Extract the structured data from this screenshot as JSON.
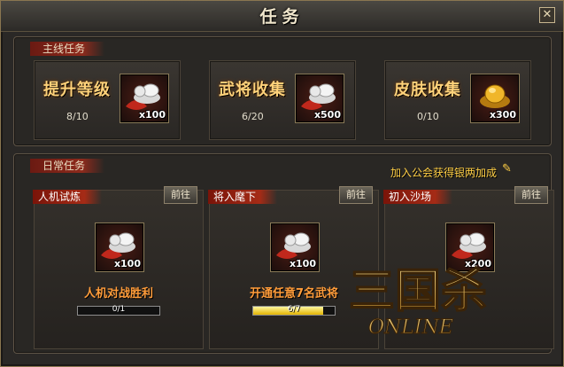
{
  "window": {
    "title": "任务",
    "close_label": "✕"
  },
  "main_quests": {
    "section_label": "主线任务",
    "cards": [
      {
        "title": "提升等级",
        "progress": "8/10",
        "reward": "x100",
        "reward_icon": "silver-ingot-icon"
      },
      {
        "title": "武将收集",
        "progress": "6/20",
        "reward": "x500",
        "reward_icon": "silver-ingot-icon"
      },
      {
        "title": "皮肤收集",
        "progress": "0/10",
        "reward": "x300",
        "reward_icon": "gold-ingot-icon"
      }
    ]
  },
  "daily_quests": {
    "section_label": "日常任务",
    "guild_bonus": "加入公会获得银两加成",
    "cards": [
      {
        "title": "人机试炼",
        "go_label": "前往",
        "reward": "x100",
        "goal": "人机对战胜利",
        "progress_text": "0/1",
        "progress": 0.0
      },
      {
        "title": "将入麾下",
        "go_label": "前往",
        "reward": "x100",
        "goal": "开通任意7名武将",
        "progress_text": "6/7",
        "progress": 0.857
      },
      {
        "title": "初入沙场",
        "go_label": "前往",
        "reward": "x200",
        "goal": "",
        "progress_text": "",
        "progress": 0.0
      }
    ]
  },
  "logo": {
    "text": "三国杀",
    "subtext": "ONLINE"
  },
  "colors": {
    "accent_gold": "#ffd27a",
    "goal_orange": "#ff9c3a",
    "tag_red": "#8e2a1c",
    "bar_fill": "#e2b400"
  }
}
